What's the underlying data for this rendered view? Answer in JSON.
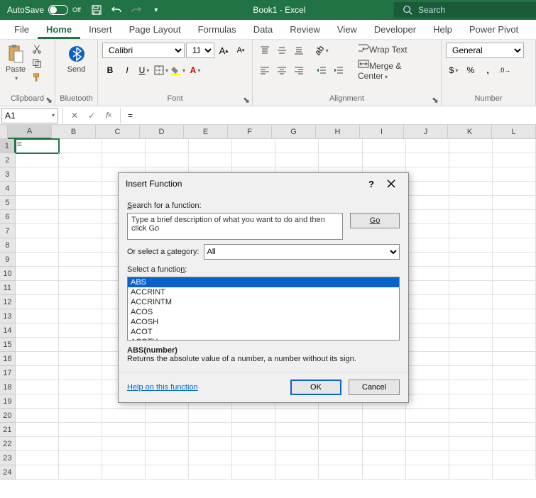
{
  "titlebar": {
    "autosave_label": "AutoSave",
    "autosave_state": "Off",
    "doc_title": "Book1 - Excel",
    "search_placeholder": "Search"
  },
  "tabs": [
    "File",
    "Home",
    "Insert",
    "Page Layout",
    "Formulas",
    "Data",
    "Review",
    "View",
    "Developer",
    "Help",
    "Power Pivot"
  ],
  "active_tab": "Home",
  "ribbon": {
    "clipboard": {
      "label": "Clipboard",
      "paste": "Paste"
    },
    "bluetooth": {
      "label": "Bluetooth",
      "send": "Send"
    },
    "font": {
      "label": "Font",
      "name": "Calibri",
      "size": "11"
    },
    "alignment": {
      "label": "Alignment",
      "wrap": "Wrap Text",
      "merge": "Merge & Center"
    },
    "number": {
      "label": "Number",
      "format": "General"
    }
  },
  "formula_bar": {
    "cellref": "A1",
    "value": "="
  },
  "columns": [
    "A",
    "B",
    "C",
    "D",
    "E",
    "F",
    "G",
    "H",
    "I",
    "J",
    "K",
    "L"
  ],
  "rows": 24,
  "active_cell": {
    "row": 1,
    "col": "A",
    "display": "="
  },
  "dialog": {
    "title": "Insert Function",
    "search_label": "Search for a function:",
    "search_text": "Type a brief description of what you want to do and then click Go",
    "go": "Go",
    "category_label": "Or select a category:",
    "category_value": "All",
    "select_label": "Select a function:",
    "functions": [
      "ABS",
      "ACCRINT",
      "ACCRINTM",
      "ACOS",
      "ACOSH",
      "ACOT",
      "ACOTH"
    ],
    "selected_function": "ABS",
    "syntax": "ABS(number)",
    "description": "Returns the absolute value of a number, a number without its sign.",
    "help": "Help on this function",
    "ok": "OK",
    "cancel": "Cancel"
  }
}
